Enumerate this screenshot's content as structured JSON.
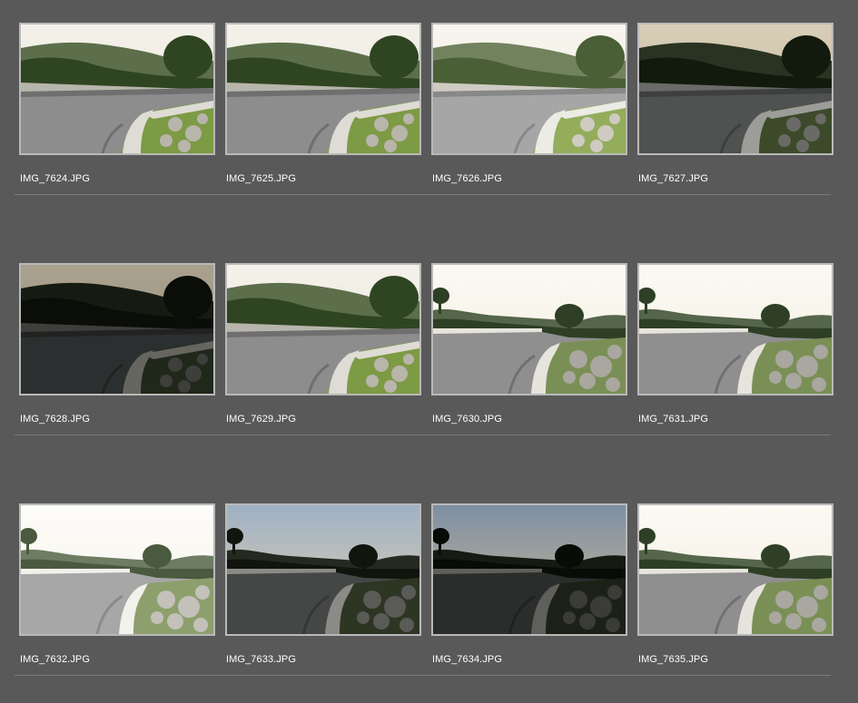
{
  "browser": {
    "thumbnails": [
      {
        "filename": "IMG_7624.JPG",
        "variant": "normal"
      },
      {
        "filename": "IMG_7625.JPG",
        "variant": "normal"
      },
      {
        "filename": "IMG_7626.JPG",
        "variant": "bright"
      },
      {
        "filename": "IMG_7627.JPG",
        "variant": "dark"
      },
      {
        "filename": "IMG_7628.JPG",
        "variant": "verydark"
      },
      {
        "filename": "IMG_7629.JPG",
        "variant": "normal"
      },
      {
        "filename": "IMG_7630.JPG",
        "variant": "wide-normal"
      },
      {
        "filename": "IMG_7631.JPG",
        "variant": "wide-normal"
      },
      {
        "filename": "IMG_7632.JPG",
        "variant": "wide-bright"
      },
      {
        "filename": "IMG_7633.JPG",
        "variant": "wide-dark"
      },
      {
        "filename": "IMG_7634.JPG",
        "variant": "wide-verydark"
      },
      {
        "filename": "IMG_7635.JPG",
        "variant": "wide-normal"
      }
    ]
  },
  "colors": {
    "background": "#595959",
    "frame": "#b9b9b9",
    "divider": "#7a7a7a",
    "text": "#ffffff"
  }
}
